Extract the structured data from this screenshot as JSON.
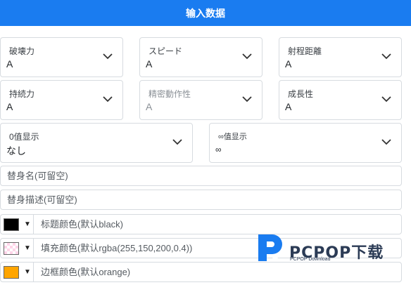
{
  "header": {
    "title": "输入数据"
  },
  "selects": {
    "destruction": {
      "label": "破壊力",
      "value": "A"
    },
    "speed": {
      "label": "スピード",
      "value": "A"
    },
    "range": {
      "label": "射程距離",
      "value": "A"
    },
    "persistence": {
      "label": "持続力",
      "value": "A"
    },
    "precision": {
      "label": "精密動作性",
      "value": "A"
    },
    "growth": {
      "label": "成長性",
      "value": "A"
    },
    "zero_display": {
      "label": "0值显示",
      "value": "なし"
    },
    "infinity_display": {
      "label": "∞值显示",
      "value": "∞"
    }
  },
  "inputs": {
    "stand_name_placeholder": "替身名(可留空)",
    "stand_desc_placeholder": "替身描述(可留空)"
  },
  "colors": {
    "title": {
      "label": "标题颜色(默认black)",
      "value": "#000000"
    },
    "fill": {
      "label": "填充颜色(默认rgba(255,150,200,0.4))",
      "value": "rgba(255,150,200,0.4)"
    },
    "border": {
      "label": "边框颜色(默认orange)",
      "value": "#ffa500"
    }
  },
  "watermark": {
    "brand": "PCPOP下载",
    "sub": "PCPOP Download"
  },
  "theme": {
    "accent": "#1a7cf0"
  }
}
